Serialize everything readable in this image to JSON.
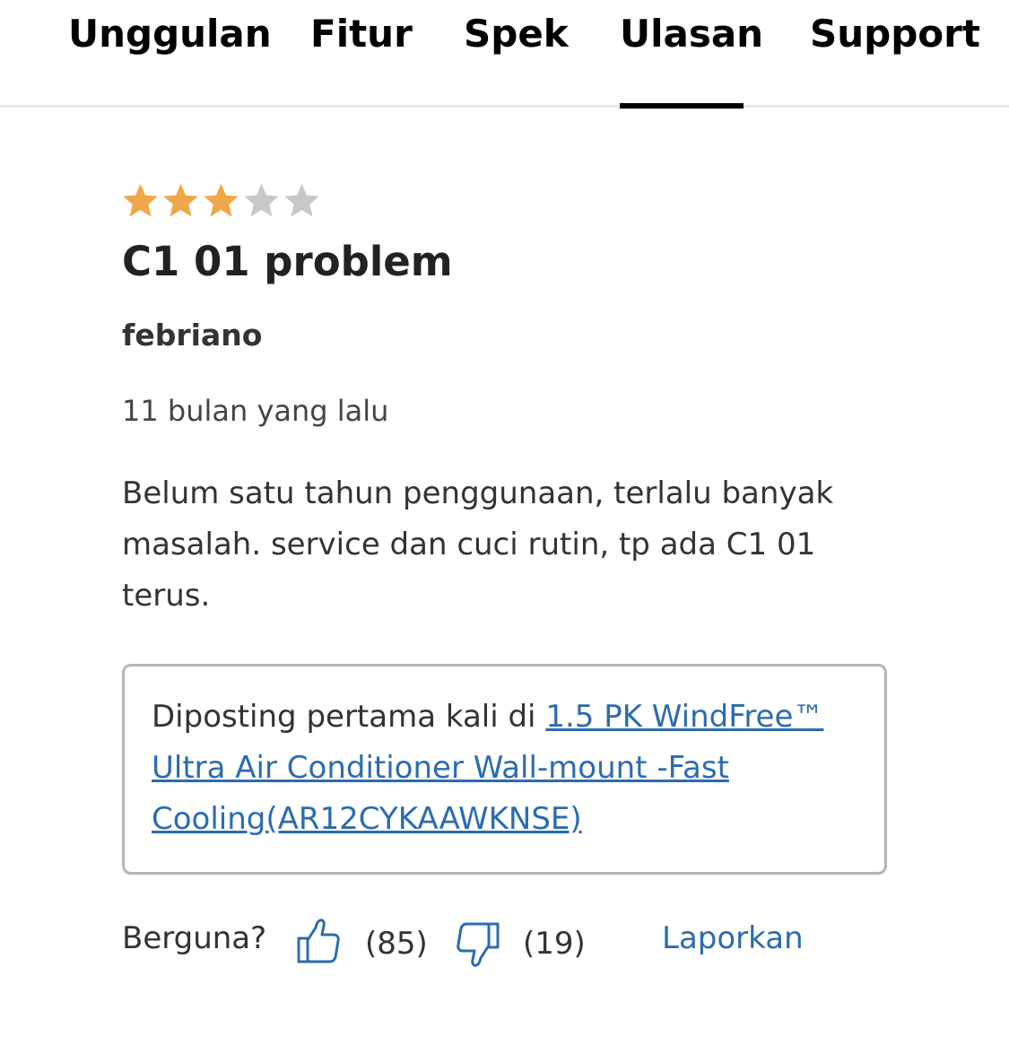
{
  "tabs": [
    {
      "label": "Unggulan"
    },
    {
      "label": "Fitur"
    },
    {
      "label": "Spek"
    },
    {
      "label": "Ulasan",
      "active": true
    },
    {
      "label": "Support"
    }
  ],
  "review": {
    "rating": 3,
    "rating_max": 5,
    "title": "C1 01 problem",
    "author": "febriano",
    "date": "11 bulan yang lalu",
    "body": "Belum satu tahun penggunaan, terlalu banyak masalah. service dan cuci rutin, tp ada C1 01 terus.",
    "origin_prefix": "Diposting pertama kali di ",
    "origin_link": "1.5 PK WindFree™ Ultra Air Conditioner Wall-mount -Fast Cooling(AR12CYKAAWKNSE)",
    "helpful_label": "Berguna?",
    "helpful_yes": "(85)",
    "helpful_no": "(19)",
    "report_label": "Laporkan"
  },
  "colors": {
    "star_filled": "#f0a74b",
    "star_empty": "#c8c8c8",
    "link": "#2b6cb0",
    "tab_active_underline": "#000000"
  },
  "icons": {
    "star": "star-icon",
    "thumbs_up": "thumbs-up-icon",
    "thumbs_down": "thumbs-down-icon"
  }
}
